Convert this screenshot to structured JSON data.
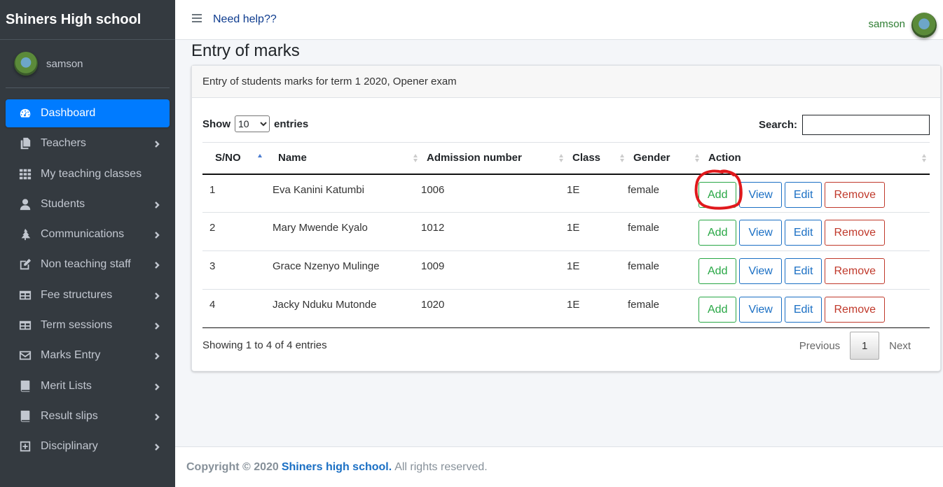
{
  "sidebar": {
    "brand": "Shiners High school",
    "user": "samson",
    "items": [
      {
        "label": "Dashboard",
        "icon": "dashboard-icon",
        "active": true,
        "chevron": false
      },
      {
        "label": "Teachers",
        "icon": "copy-icon",
        "chevron": true
      },
      {
        "label": "My teaching classes",
        "icon": "grid-icon",
        "chevron": false
      },
      {
        "label": "Students",
        "icon": "user-icon",
        "chevron": true
      },
      {
        "label": "Communications",
        "icon": "tree-icon",
        "chevron": true
      },
      {
        "label": "Non teaching staff",
        "icon": "edit-icon",
        "chevron": true
      },
      {
        "label": "Fee structures",
        "icon": "table-icon",
        "chevron": true
      },
      {
        "label": "Term sessions",
        "icon": "table-icon",
        "chevron": true
      },
      {
        "label": "Marks Entry",
        "icon": "envelope-icon",
        "chevron": true
      },
      {
        "label": "Merit Lists",
        "icon": "book-icon",
        "chevron": true
      },
      {
        "label": "Result slips",
        "icon": "book-icon",
        "chevron": true
      },
      {
        "label": "Disciplinary",
        "icon": "plus-square-icon",
        "chevron": true
      }
    ]
  },
  "topbar": {
    "help": "Need help??",
    "user": "samson"
  },
  "page": {
    "title": "Entry of marks",
    "card_header": "Entry of students marks for term 1 2020, Opener exam"
  },
  "table_controls": {
    "show": "Show",
    "entries": "entries",
    "page_length": "10",
    "search_label": "Search:",
    "search_value": ""
  },
  "table": {
    "headers": [
      "S/NO",
      "Name",
      "Admission number",
      "Class",
      "Gender",
      "Action"
    ],
    "rows": [
      {
        "sno": "1",
        "name": "Eva Kanini Katumbi",
        "adm": "1006",
        "class": "1E",
        "gender": "female"
      },
      {
        "sno": "2",
        "name": "Mary Mwende Kyalo",
        "adm": "1012",
        "class": "1E",
        "gender": "female"
      },
      {
        "sno": "3",
        "name": "Grace Nzenyo Mulinge",
        "adm": "1009",
        "class": "1E",
        "gender": "female"
      },
      {
        "sno": "4",
        "name": "Jacky Nduku Mutonde",
        "adm": "1020",
        "class": "1E",
        "gender": "female"
      }
    ],
    "actions": {
      "add": "Add",
      "view": "View",
      "edit": "Edit",
      "remove": "Remove"
    }
  },
  "pagination": {
    "info": "Showing 1 to 4 of 4 entries",
    "previous": "Previous",
    "current": "1",
    "next": "Next"
  },
  "footer": {
    "prefix": "Copyright © 2020",
    "org": "Shiners high school.",
    "suffix": "All rights reserved."
  },
  "colors": {
    "sidebar_bg": "#343a40",
    "active": "#007bff",
    "add": "#28a745",
    "view_edit": "#1a6fc4",
    "remove": "#c0392b",
    "annotation": "#e0191c"
  }
}
